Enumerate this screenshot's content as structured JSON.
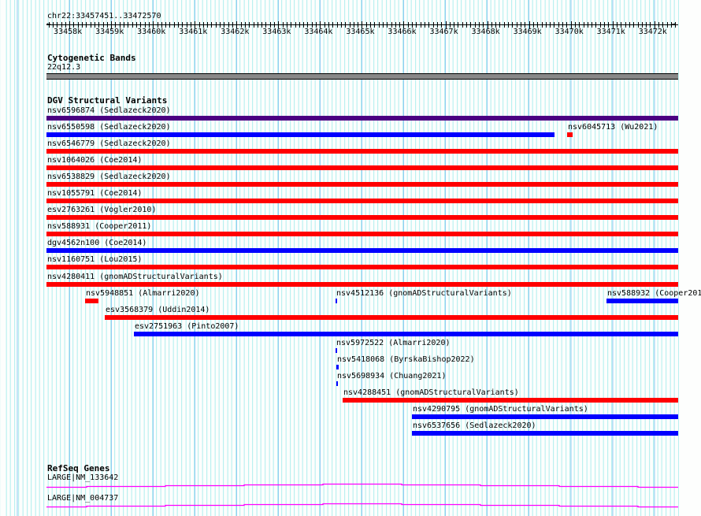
{
  "locus": "chr22:33457451..33472570",
  "view": {
    "start": 33457451,
    "end": 33472570
  },
  "ruler": {
    "labels": [
      "33458k",
      "33459k",
      "33460k",
      "33461k",
      "33462k",
      "33463k",
      "33464k",
      "33465k",
      "33466k",
      "33467k",
      "33468k",
      "33469k",
      "33470k",
      "33471k",
      "33472k"
    ]
  },
  "tracks": {
    "cytoband": {
      "title": "Cytogenetic Bands",
      "band": "22q12.3"
    },
    "dgv": {
      "title": "DGV Structural Variants",
      "colors": {
        "loss": "#ff0000",
        "gain": "#0000ff",
        "complex": "#4b0082"
      },
      "rows": [
        [
          {
            "label": "nsv6596874 (Sedlazeck2020)",
            "start": 33457451,
            "end": 33472570,
            "type": "complex"
          }
        ],
        [
          {
            "label": "nsv6550598 (Sedlazeck2020)",
            "start": 33457451,
            "end": 33469611,
            "type": "gain"
          },
          {
            "label": "nsv6045713 (Wu2021)",
            "start": 33469913,
            "end": 33470045,
            "type": "loss"
          }
        ],
        [
          {
            "label": "nsv6546779 (Sedlazeck2020)",
            "start": 33457451,
            "end": 33472570,
            "type": "loss"
          }
        ],
        [
          {
            "label": "nsv1064026 (Coe2014)",
            "start": 33457451,
            "end": 33472570,
            "type": "loss"
          }
        ],
        [
          {
            "label": "nsv6538829 (Sedlazeck2020)",
            "start": 33457451,
            "end": 33472570,
            "type": "loss"
          }
        ],
        [
          {
            "label": "nsv1055791 (Coe2014)",
            "start": 33457451,
            "end": 33472570,
            "type": "loss"
          }
        ],
        [
          {
            "label": "esv2763261 (Vogler2010)",
            "start": 33457451,
            "end": 33472570,
            "type": "loss"
          }
        ],
        [
          {
            "label": "nsv588931 (Cooper2011)",
            "start": 33457451,
            "end": 33472570,
            "type": "loss"
          }
        ],
        [
          {
            "label": "dgv4562n100 (Coe2014)",
            "start": 33457451,
            "end": 33472570,
            "type": "gain"
          }
        ],
        [
          {
            "label": "nsv1160751 (Lou2015)",
            "start": 33457451,
            "end": 33472570,
            "type": "loss"
          }
        ],
        [
          {
            "label": "nsv4280411 (gnomADStructuralVariants)",
            "start": 33457451,
            "end": 33472570,
            "type": "loss"
          }
        ],
        [
          {
            "label": "nsv5948851 (Almarri2020)",
            "start": 33458375,
            "end": 33458695,
            "type": "loss"
          },
          {
            "label": "nsv4512136 (gnomADStructuralVariants)",
            "start": 33464370,
            "end": 33464408,
            "type": "gain"
          },
          {
            "label": "nsv588932 (Cooper201",
            "start": 33470855,
            "end": 33472570,
            "type": "gain"
          }
        ],
        [
          {
            "label": "esv3568379 (Uddin2014)",
            "start": 33458846,
            "end": 33472570,
            "type": "loss"
          }
        ],
        [
          {
            "label": "esv2751963 (Pinto2007)",
            "start": 33459544,
            "end": 33472570,
            "type": "gain"
          }
        ],
        [
          {
            "label": "nsv5972522 (Almarri2020)",
            "start": 33464370,
            "end": 33464408,
            "type": "gain"
          }
        ],
        [
          {
            "label": "nsv5418068 (ByrskaBishop2022)",
            "start": 33464389,
            "end": 33464445,
            "type": "gain"
          }
        ],
        [
          {
            "label": "nsv5698934 (Chuang2021)",
            "start": 33464389,
            "end": 33464427,
            "type": "gain"
          }
        ],
        [
          {
            "label": "nsv4288451 (gnomADStructuralVariants)",
            "start": 33464540,
            "end": 33472570,
            "type": "loss"
          }
        ],
        [
          {
            "label": "nsv4290795 (gnomADStructuralVariants)",
            "start": 33466199,
            "end": 33472570,
            "type": "gain"
          }
        ],
        [
          {
            "label": "nsv6537656 (Sedlazeck2020)",
            "start": 33466199,
            "end": 33472570,
            "type": "gain"
          }
        ]
      ]
    },
    "refseq": {
      "title": "RefSeq Genes",
      "color": "#ff00ff",
      "genes": [
        {
          "label": "LARGE|NM_133642"
        },
        {
          "label": "LARGE|NM_004737"
        }
      ]
    }
  }
}
